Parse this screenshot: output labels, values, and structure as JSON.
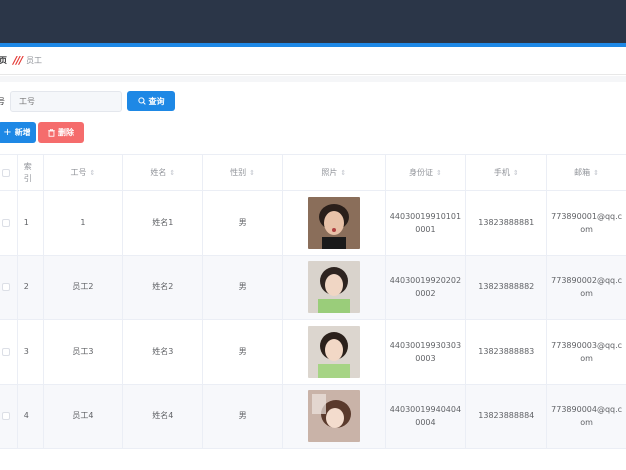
{
  "breadcrumb": {
    "home": "页",
    "current": "员工"
  },
  "search": {
    "label": "号",
    "placeholder": "工号",
    "query_button": "查询"
  },
  "actions": {
    "add": "新增",
    "delete": "删除"
  },
  "table": {
    "headers": {
      "index": "索引",
      "job_no": "工号",
      "name": "姓名",
      "gender": "性别",
      "photo": "照片",
      "id_card": "身份证",
      "phone": "手机",
      "email": "邮箱"
    },
    "rows": [
      {
        "index": "1",
        "job_no": "1",
        "name": "姓名1",
        "gender": "男",
        "photo_icon": "portrait-photo",
        "id_card": "440300199101010001",
        "phone": "13823888881",
        "email": "773890001@qq.com"
      },
      {
        "index": "2",
        "job_no": "员工2",
        "name": "姓名2",
        "gender": "男",
        "photo_icon": "portrait-photo",
        "id_card": "440300199202020002",
        "phone": "13823888882",
        "email": "773890002@qq.com"
      },
      {
        "index": "3",
        "job_no": "员工3",
        "name": "姓名3",
        "gender": "男",
        "photo_icon": "portrait-photo",
        "id_card": "440300199303030003",
        "phone": "13823888883",
        "email": "773890003@qq.com"
      },
      {
        "index": "4",
        "job_no": "员工4",
        "name": "姓名4",
        "gender": "男",
        "photo_icon": "portrait-photo",
        "id_card": "440300199404040004",
        "phone": "13823888884",
        "email": "773890004@qq.com"
      }
    ]
  },
  "colors": {
    "header_bg": "#2b3648",
    "accent": "#1e88e5",
    "danger": "#f56c6c"
  }
}
